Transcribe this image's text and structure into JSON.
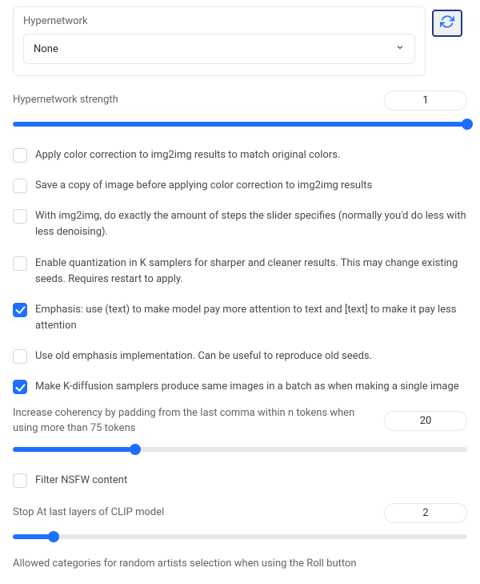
{
  "hypernetwork": {
    "label": "Hypernetwork",
    "selected": "None"
  },
  "strength": {
    "label": "Hypernetwork strength",
    "value": "1",
    "fillPercent": 100
  },
  "cb_color_correction": {
    "label": "Apply color correction to img2img results to match original colors.",
    "checked": false
  },
  "cb_save_copy": {
    "label": "Save a copy of image before applying color correction to img2img results",
    "checked": false
  },
  "cb_exact_steps": {
    "label": "With img2img, do exactly the amount of steps the slider specifies (normally you'd do less with less denoising).",
    "checked": false
  },
  "cb_quantization": {
    "label": "Enable quantization in K samplers for sharper and cleaner results. This may change existing seeds. Requires restart to apply.",
    "checked": false
  },
  "cb_emphasis": {
    "label": "Emphasis: use (text) to make model pay more attention to text and [text] to make it pay less attention",
    "checked": true
  },
  "cb_old_emphasis": {
    "label": "Use old emphasis implementation. Can be useful to reproduce old seeds.",
    "checked": false
  },
  "cb_batch_same": {
    "label": "Make K-diffusion samplers produce same images in a batch as when making a single image",
    "checked": true
  },
  "coherency": {
    "label": "Increase coherency by padding from the last comma within n tokens when using more than 75 tokens",
    "value": "20",
    "fillPercent": 27
  },
  "cb_nsfw": {
    "label": "Filter NSFW content",
    "checked": false
  },
  "clip_stop": {
    "label": "Stop At last layers of CLIP model",
    "value": "2",
    "fillPercent": 9
  },
  "allowed_categories_label": "Allowed categories for random artists selection when using the Roll button"
}
